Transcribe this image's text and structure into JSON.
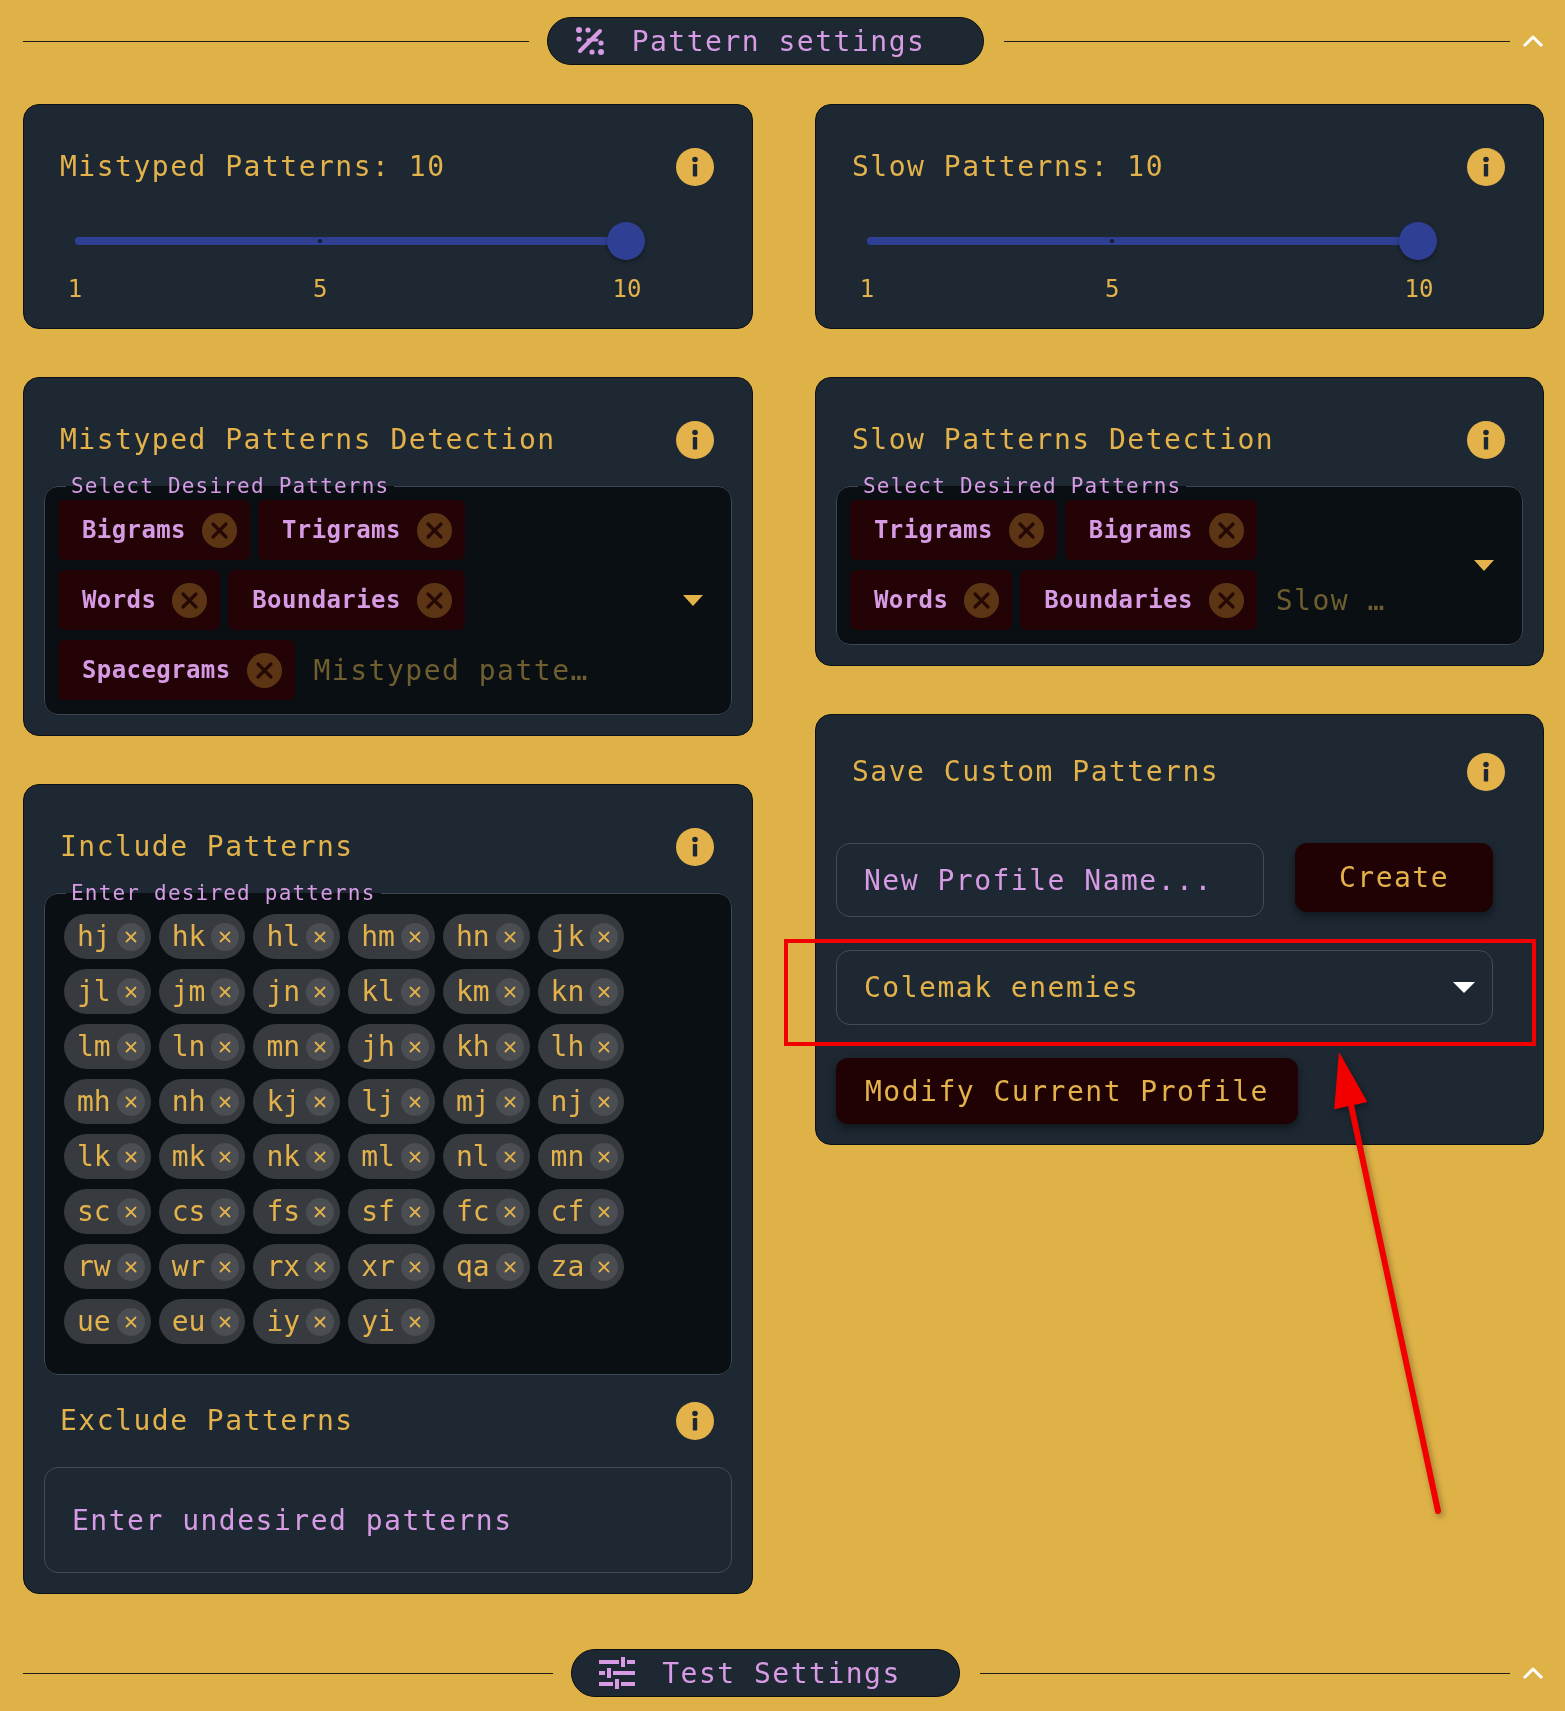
{
  "top_section": {
    "title": "Pattern settings",
    "expanded": true
  },
  "columns": [
    {
      "slider": {
        "label": "Mistyped Patterns: 10",
        "level": 1,
        "marks": [
          "1",
          "5",
          "10"
        ]
      },
      "detection": {
        "title": "Mistyped Patterns Detection",
        "field_label": "Select Desired Patterns",
        "chips": [
          "Bigrams",
          "Trigrams",
          "Words",
          "Boundaries",
          "Spacegrams"
        ],
        "placeholder": "Mistyped patte…"
      },
      "include": {
        "title": "Include Patterns",
        "field_label": "Enter desired patterns",
        "tags": [
          "hj",
          "hk",
          "hl",
          "hm",
          "hn",
          "jk",
          "jl",
          "jm",
          "jn",
          "kl",
          "km",
          "kn",
          "lm",
          "ln",
          "mn",
          "jh",
          "kh",
          "lh",
          "mh",
          "nh",
          "kj",
          "lj",
          "mj",
          "nj",
          "lk",
          "mk",
          "nk",
          "ml",
          "nl",
          "mn",
          "sc",
          "cs",
          "fs",
          "sf",
          "fc",
          "cf",
          "rw",
          "wr",
          "rx",
          "xr",
          "qa",
          "za",
          "ue",
          "eu",
          "iy",
          "yi"
        ]
      },
      "exclude": {
        "title": "Exclude Patterns",
        "placeholder": "Enter undesired patterns"
      }
    },
    {
      "slider": {
        "label": "Slow Patterns: 10",
        "level": 1,
        "marks": [
          "1",
          "5",
          "10"
        ]
      },
      "detection": {
        "title": "Slow Patterns Detection",
        "field_label": "Select Desired Patterns",
        "chips": [
          "Trigrams",
          "Bigrams",
          "Words",
          "Boundaries"
        ],
        "placeholder": "Slow …"
      },
      "profiles": {
        "title": "Save Custom Patterns",
        "name_placeholder": "New Profile Name...",
        "create_button": "Create",
        "selected_profile": "Colemak enemies",
        "modify_button": "Modify Current Profile"
      }
    }
  ],
  "annotation": {
    "frame": true,
    "arrow": true
  },
  "next_section": {
    "title": "Test Settings",
    "expanded": true
  }
}
